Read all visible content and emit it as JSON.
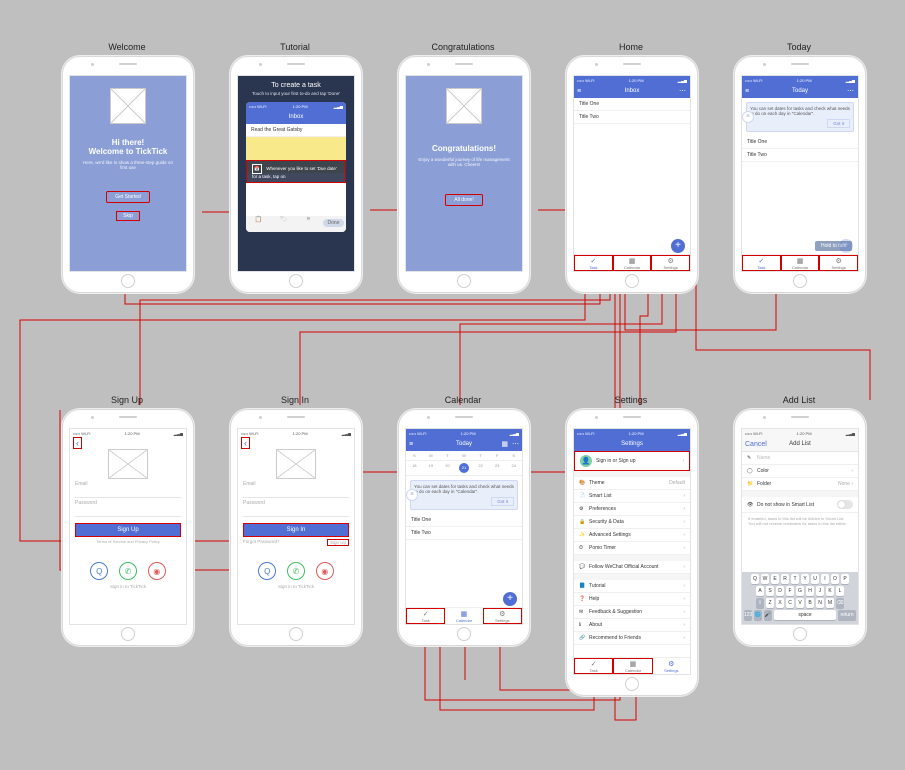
{
  "status": {
    "carrier": "••••• Wi-Fi",
    "time": "1:20 PM",
    "batt": "▂▃▅"
  },
  "screens": {
    "welcome": {
      "title": "Welcome",
      "heading1": "Hi there!",
      "heading2": "Welcome to TickTick",
      "sub": "Here, we'd like to show a three-step guide on first use",
      "get_started": "Get Started",
      "skip": "Skip"
    },
    "tutorial": {
      "title": "Tutorial",
      "heading": "To create a task",
      "sub": "Touch to input your first to-do and tap 'Done'",
      "inner_nav": "Inbox",
      "sample_task": "Read the Great Gatsby",
      "hint": "Whenever you like to set 'Due date' for a task, tap on"
    },
    "congrats": {
      "title": "Congratulations",
      "heading": "Congratulations!",
      "sub": "Enjoy a wonderful journey of life management with us. Cheers!",
      "all_done": "All done!"
    },
    "home": {
      "title": "Home",
      "nav": "Inbox",
      "task1": "Title One",
      "task2": "Title Two",
      "hamburger": "≡",
      "more": "⋯",
      "tabs": {
        "task": "Task",
        "calendar": "Calendar",
        "settings": "Settings"
      }
    },
    "today": {
      "title": "Today",
      "nav": "Today",
      "tip": "You can set dates for tasks and check what needs to do on each day in \"Calendar\".",
      "gotit": "Got it",
      "task1": "Title One",
      "task2": "Title Two",
      "hold": "Hold to talk"
    },
    "signup": {
      "title": "Sign Up",
      "email": "Email",
      "password": "Password",
      "btn": "Sign Up",
      "terms": "Terms of Service and Privacy Policy",
      "footer": "Sign in to TickTick"
    },
    "signin": {
      "title": "Sign In",
      "email": "Email",
      "password": "Password",
      "btn": "Sign In",
      "forgot": "Forgot Password?",
      "create": "Sign Up",
      "footer": "Sign in to TickTick"
    },
    "calendar": {
      "title": "Calendar",
      "nav": "Today",
      "days": [
        "S",
        "M",
        "T",
        "W",
        "T",
        "F",
        "S"
      ],
      "dates": [
        "18",
        "19",
        "20",
        "21",
        "22",
        "23",
        "24"
      ],
      "tip": "You can set dates for tasks and check what needs to do on each day in \"Calendar\".",
      "gotit": "Got it",
      "task1": "Title One",
      "task2": "Title Two"
    },
    "settings": {
      "title": "Settings",
      "nav": "Settings",
      "signin": "Sign in or Sign up",
      "theme": {
        "label": "Theme",
        "value": "Default"
      },
      "items": [
        "Smart List",
        "Preferences",
        "Security & Data",
        "Advanced Settings",
        "Pomo Timer"
      ],
      "follow": "Follow WeChat Official Account",
      "items2": [
        "Tutorial",
        "Help",
        "Feedback & Suggestion",
        "About",
        "Recommend to Friends"
      ],
      "tabs": {
        "task": "Task",
        "calendar": "Calendar",
        "settings": "Settings"
      }
    },
    "addlist": {
      "title": "Add List",
      "nav": "Add List",
      "cancel": "Cancel",
      "name": "Name",
      "color": "Color",
      "folder": "Folder",
      "folder_val": "None",
      "smart_toggle": "Do not show in Smart List",
      "smart_sub": "If enabled, tasks in this list will be hidden in Smart List. You will not receive reminders for tasks in this list either.",
      "keys_r1": [
        "Q",
        "W",
        "E",
        "R",
        "T",
        "Y",
        "U",
        "I",
        "O",
        "P"
      ],
      "keys_r2": [
        "A",
        "S",
        "D",
        "F",
        "G",
        "H",
        "J",
        "K",
        "L"
      ],
      "keys_r3": [
        "Z",
        "X",
        "C",
        "V",
        "B",
        "N",
        "M"
      ],
      "shift": "⇧",
      "del": "⌫",
      "num": "123",
      "globe": "🌐",
      "mic": "🎤",
      "space": "space",
      "ret": "return"
    }
  }
}
